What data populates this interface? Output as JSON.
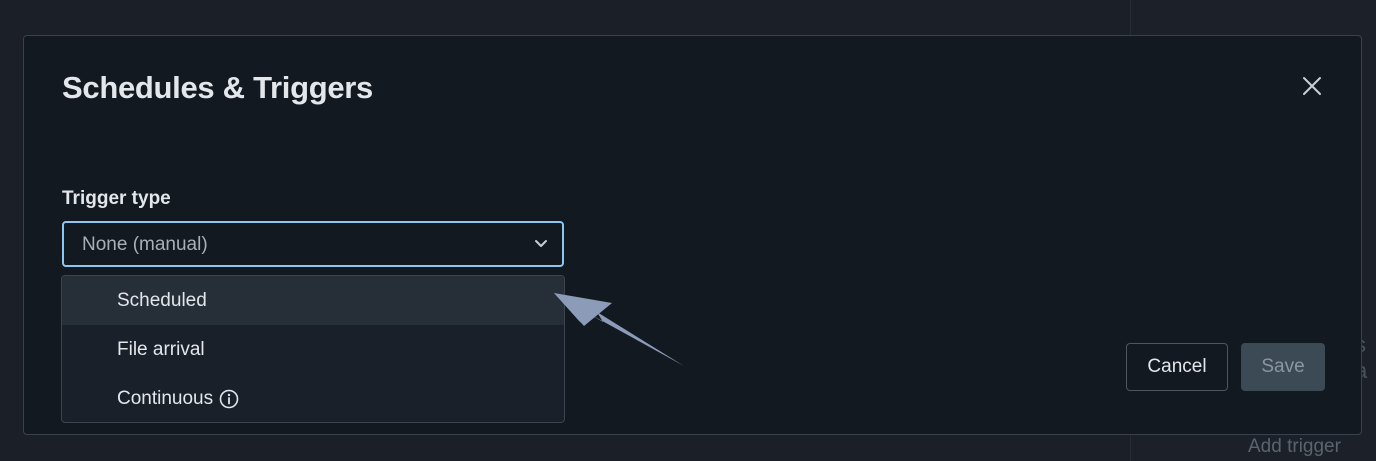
{
  "background": {
    "add_trigger_label": "Add trigger",
    "peek_text": "s a"
  },
  "modal": {
    "title": "Schedules & Triggers",
    "close_icon": "close-icon"
  },
  "trigger_type": {
    "label": "Trigger type",
    "selected_value": "None (manual)",
    "chevron_icon": "chevron-down-icon"
  },
  "dropdown": {
    "options": [
      {
        "label": "Scheduled",
        "highlighted": true
      },
      {
        "label": "File arrival",
        "highlighted": false
      },
      {
        "label": "Continuous",
        "highlighted": false,
        "icon": "info-icon"
      }
    ]
  },
  "footer": {
    "cancel_label": "Cancel",
    "save_label": "Save"
  },
  "colors": {
    "accent_focus": "#8cc6f2",
    "modal_bg": "#131921",
    "text_primary": "#e3e7eb",
    "annotation_arrow": "#8b9bb8"
  }
}
